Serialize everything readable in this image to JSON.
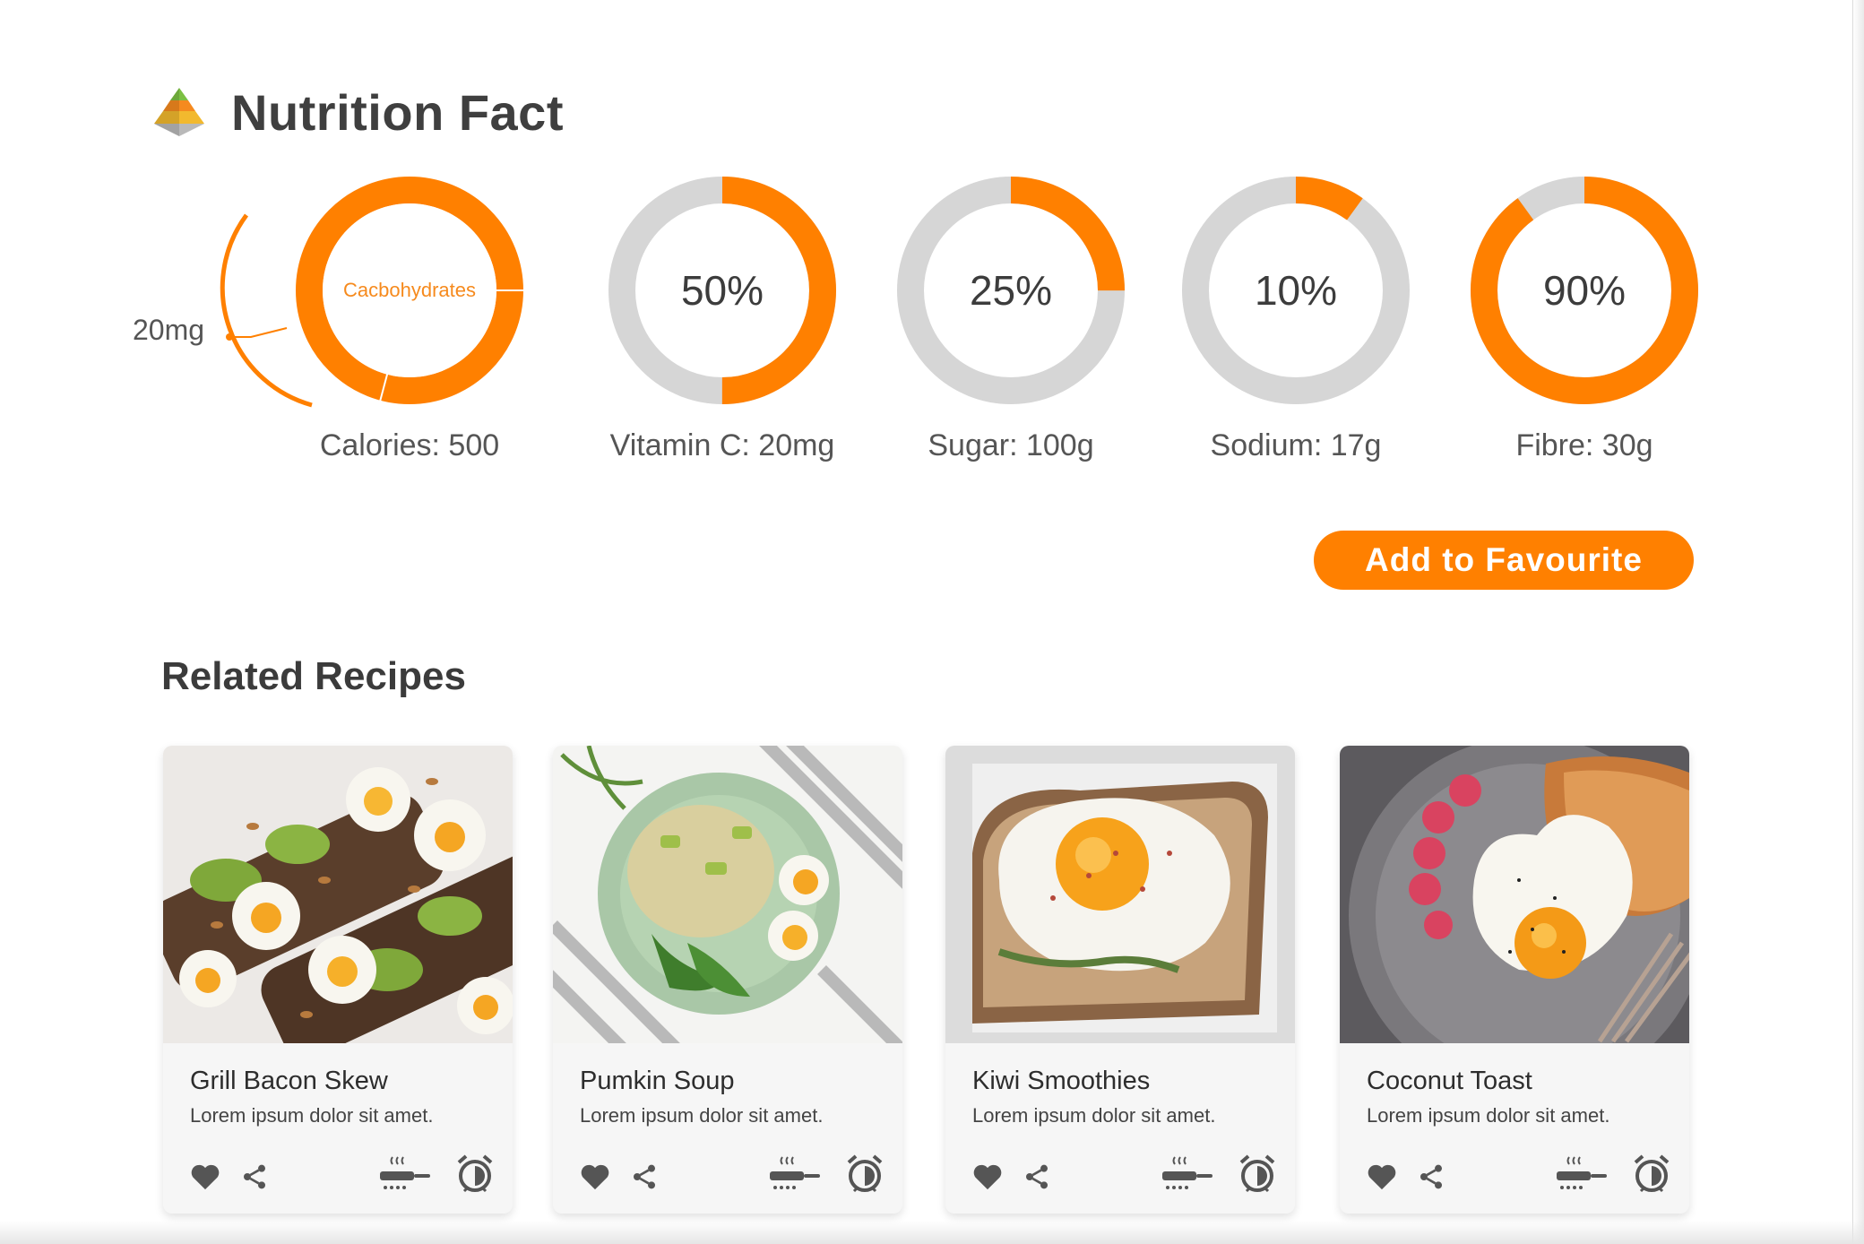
{
  "header": {
    "title": "Nutrition Fact",
    "logo_icon": "food-pyramid-icon"
  },
  "accent_color": "#ff8000",
  "track_color": "#d6d6d6",
  "nutrients": [
    {
      "name": "Calories",
      "label": "Calories: 500",
      "center_text": "Cacbohydrates",
      "annotation": "20mg",
      "percent": 100
    },
    {
      "name": "Vitamin C",
      "label": "Vitamin C: 20mg",
      "center_text": "50%",
      "percent": 50
    },
    {
      "name": "Sugar",
      "label": "Sugar: 100g",
      "center_text": "25%",
      "percent": 25
    },
    {
      "name": "Sodium",
      "label": "Sodium: 17g",
      "center_text": "10%",
      "percent": 10
    },
    {
      "name": "Fibre",
      "label": "Fibre: 30g",
      "center_text": "90%",
      "percent": 90
    }
  ],
  "favourite_button": "Add to Favourite",
  "related": {
    "title": "Related Recipes",
    "recipes": [
      {
        "title": "Grill Bacon Skew",
        "desc": "Lorem ipsum dolor sit amet."
      },
      {
        "title": "Pumkin Soup",
        "desc": "Lorem ipsum dolor sit amet."
      },
      {
        "title": "Kiwi Smoothies",
        "desc": "Lorem ipsum dolor sit amet."
      },
      {
        "title": "Coconut Toast",
        "desc": "Lorem ipsum dolor sit amet."
      }
    ],
    "action_icons": [
      "heart-icon",
      "share-icon",
      "cooking-pan-icon",
      "alarm-clock-icon"
    ]
  }
}
